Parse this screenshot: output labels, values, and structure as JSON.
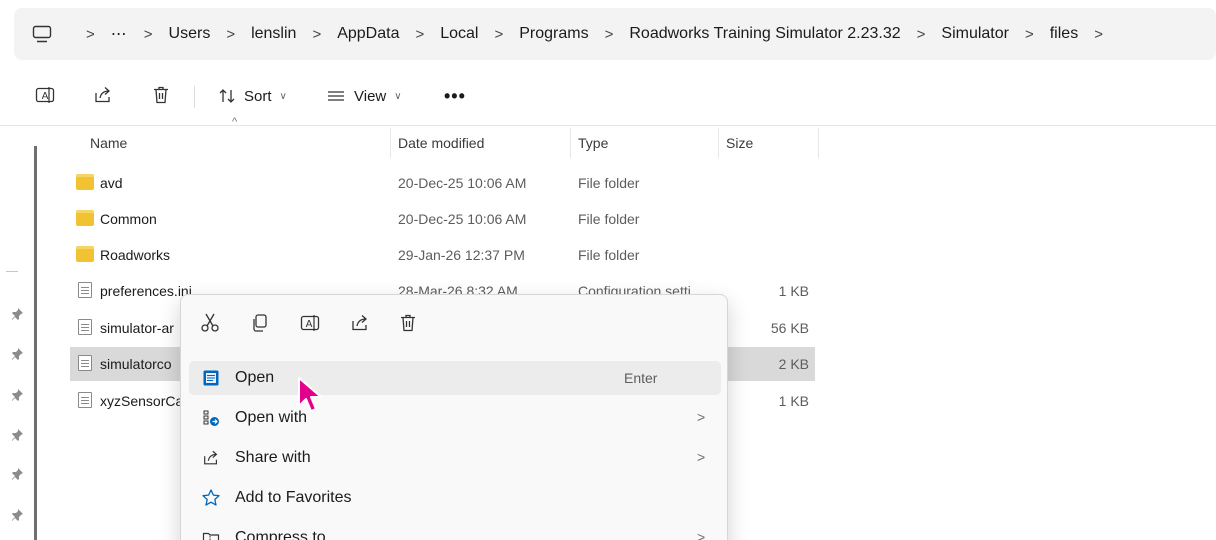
{
  "address_bar": {
    "more": "⋯",
    "crumbs": [
      "Users",
      "lenslin",
      "AppData",
      "Local",
      "Programs",
      "Roadworks Training Simulator 2.23.32",
      "Simulator",
      "files"
    ],
    "separator": ">"
  },
  "command_bar": {
    "sort_label": "Sort",
    "view_label": "View",
    "more_label": "•••",
    "chevron": "∨"
  },
  "columns": {
    "name": "Name",
    "date": "Date modified",
    "type": "Type",
    "size": "Size",
    "sort_caret": "^"
  },
  "files": [
    {
      "name": "avd",
      "date": "20-Dec-25 10:06 AM",
      "type": "File folder",
      "size": "",
      "icon": "folder-icon"
    },
    {
      "name": "Common",
      "date": "20-Dec-25 10:06 AM",
      "type": "File folder",
      "size": "",
      "icon": "folder-icon"
    },
    {
      "name": "Roadworks",
      "date": "29-Jan-26 12:37 PM",
      "type": "File folder",
      "size": "",
      "icon": "folder-icon"
    },
    {
      "name": "preferences.ini",
      "date": "28-Mar-26 8:32 AM",
      "type": "Configuration setti",
      "size": "1 KB",
      "icon": "ini-file-icon"
    },
    {
      "name": "simulator-ar",
      "date": "",
      "type": "",
      "size": "56 KB",
      "icon": "document-icon"
    },
    {
      "name": "simulatorco",
      "date": "",
      "type": "",
      "size": "2 KB",
      "icon": "document-icon"
    },
    {
      "name": "xyzSensorCa",
      "date": "",
      "type": "",
      "size": "1 KB",
      "icon": "document-icon"
    }
  ],
  "context_menu": {
    "toolbar": [
      "cut-icon",
      "copy-icon",
      "rename-icon",
      "share-icon",
      "delete-icon"
    ],
    "items": [
      {
        "label": "Open",
        "shortcut": "Enter",
        "arrow": ""
      },
      {
        "label": "Open with",
        "shortcut": "",
        "arrow": ">"
      },
      {
        "label": "Share with",
        "shortcut": "",
        "arrow": ">"
      },
      {
        "label": "Add to Favorites",
        "shortcut": "",
        "arrow": ""
      },
      {
        "label": "Compress to",
        "shortcut": "",
        "arrow": ">"
      }
    ]
  },
  "colors": {
    "accent": "#0067c0",
    "cursor": "#e3008c",
    "folder": "#f1c232",
    "selected_row": "#d9d9d9"
  }
}
